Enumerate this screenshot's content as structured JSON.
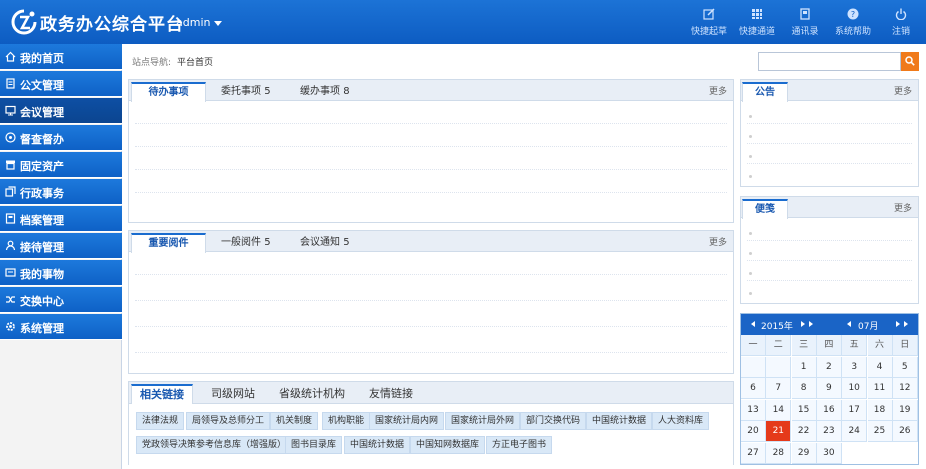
{
  "header": {
    "title": "政务办公综合平台",
    "user": "admin",
    "tools": [
      {
        "label": "快捷起草",
        "icon": "edit-icon"
      },
      {
        "label": "快捷通道",
        "icon": "grid-icon"
      },
      {
        "label": "通讯录",
        "icon": "contacts-icon"
      },
      {
        "label": "系统帮助",
        "icon": "help-icon"
      },
      {
        "label": "注销",
        "icon": "power-icon"
      }
    ]
  },
  "sidebar": {
    "items": [
      {
        "label": "我的首页",
        "icon": "home-icon"
      },
      {
        "label": "公文管理",
        "icon": "document-icon"
      },
      {
        "label": "会议管理",
        "icon": "monitor-icon",
        "active": true
      },
      {
        "label": "督查督办",
        "icon": "circle-icon"
      },
      {
        "label": "固定资产",
        "icon": "store-icon"
      },
      {
        "label": "行政事务",
        "icon": "copy-icon"
      },
      {
        "label": "档案管理",
        "icon": "archive-icon"
      },
      {
        "label": "接待管理",
        "icon": "user-icon"
      },
      {
        "label": "我的事物",
        "icon": "card-icon"
      },
      {
        "label": "交换中心",
        "icon": "shuffle-icon"
      },
      {
        "label": "系统管理",
        "icon": "settings-icon"
      }
    ]
  },
  "breadcrumb": {
    "prefix": "站点导航:",
    "current": "平台首页"
  },
  "search": {
    "placeholder": ""
  },
  "panel1": {
    "tabs": [
      {
        "label": "待办事项"
      },
      {
        "label": "委托事项",
        "count": "5"
      },
      {
        "label": "缓办事项",
        "count": "8"
      }
    ],
    "more": "更多"
  },
  "panel2": {
    "tabs": [
      {
        "label": "重要阅件"
      },
      {
        "label": "一般阅件",
        "count": "5"
      },
      {
        "label": "会议通知",
        "count": "5"
      }
    ],
    "more": "更多"
  },
  "notice": {
    "title": "公告",
    "more": "更多"
  },
  "memo": {
    "title": "便笺",
    "more": "更多"
  },
  "links": {
    "tabs": [
      "相关链接",
      "司级网站",
      "省级统计机构",
      "友情链接"
    ],
    "items": [
      "法律法规",
      "局领导及总师分工",
      "机关制度",
      "机构职能",
      "国家统计局内网",
      "国家统计局外网",
      "部门交换代码",
      "中国统计数据",
      "人大资料库",
      "党政领导决策参考信息库（增强版）",
      "图书目录库",
      "中国统计数据",
      "中国知网数据库",
      "方正电子图书"
    ]
  },
  "calendar": {
    "year": "2015年",
    "month": "07月",
    "weekdays": [
      "一",
      "二",
      "三",
      "四",
      "五",
      "六",
      "日"
    ],
    "days": [
      "1",
      "2",
      "3",
      "4",
      "5",
      "6",
      "7",
      "8",
      "9",
      "10",
      "11",
      "12",
      "13",
      "14",
      "15",
      "16",
      "17",
      "18",
      "19",
      "20",
      "21",
      "22",
      "23",
      "24",
      "25",
      "26",
      "27",
      "28",
      "29",
      "30"
    ],
    "today": "21",
    "colors": {
      "today": "#e53a1a",
      "header": "#1a64c6"
    }
  },
  "colors": {
    "brand": "#0d5cc2",
    "accent": "#f07a1a"
  }
}
